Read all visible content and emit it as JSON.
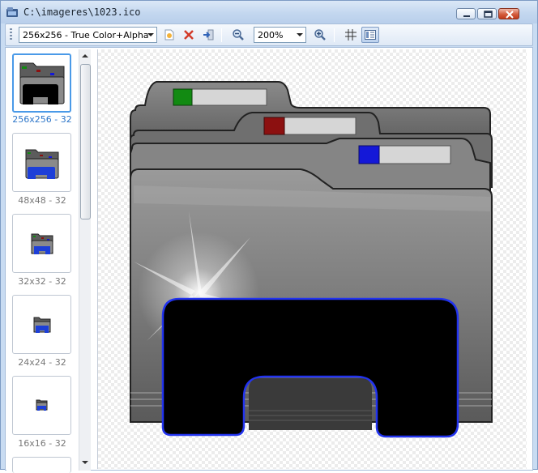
{
  "window": {
    "title": "C:\\imageres\\1023.ico"
  },
  "toolbar": {
    "format_select_value": "256x256 - True Color+Alpha",
    "zoom_select_value": "200%"
  },
  "thumbnails": [
    {
      "label": "256x256 - 32",
      "selected": true
    },
    {
      "label": "48x48 - 32",
      "selected": false
    },
    {
      "label": "32x32 - 32",
      "selected": false
    },
    {
      "label": "24x24 - 32",
      "selected": false
    },
    {
      "label": "16x16 - 32",
      "selected": false
    }
  ],
  "colors": {
    "selection_accent": "#4a9ae8",
    "folder_tab_green": "#128a12",
    "folder_tab_red": "#8c1010",
    "folder_tab_blue": "#1418d8",
    "overlay_outline_blue": "#2233ee"
  },
  "icons": [
    "app-icon",
    "minimize-icon",
    "maximize-icon",
    "close-icon",
    "new-image-icon",
    "delete-image-icon",
    "export-icon",
    "zoom-out-icon",
    "zoom-in-icon",
    "grid-icon",
    "thumbnails-view-icon"
  ]
}
